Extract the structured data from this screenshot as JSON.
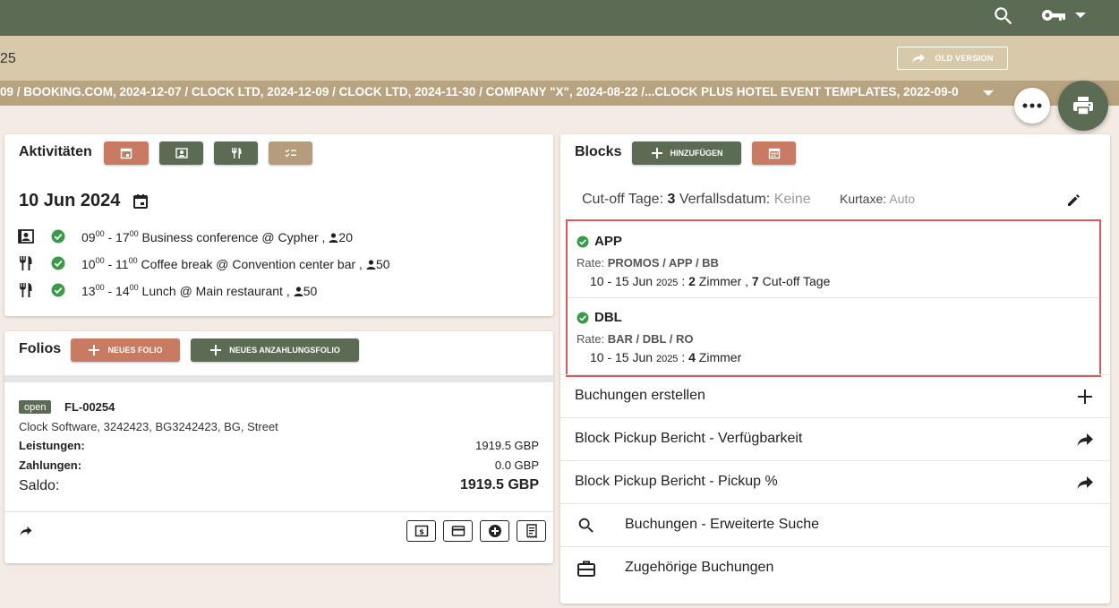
{
  "header": {
    "search_icon": "search-icon",
    "key_icon": "key-icon",
    "menu_caret": "chevron-down-icon"
  },
  "subbar": {
    "title_fragment": "25",
    "old_version_label": "OLD VERSION"
  },
  "breadcrumbs": {
    "text": "09  /  BOOKING.COM, 2024-12-07  /  CLOCK LTD, 2024-12-09  /  CLOCK LTD, 2024-11-30  /  COMPANY \"X\", 2024-08-22  /...CLOCK PLUS HOTEL EVENT TEMPLATES, 2022-09-0"
  },
  "activities": {
    "title": "Aktivitäten",
    "date": "10 Jun 2024",
    "items": [
      {
        "start": "09",
        "start_sup": "00",
        "end": "17",
        "end_sup": "00",
        "desc": "Business conference @ Cypher ,",
        "count": "20",
        "icon": "conference-icon"
      },
      {
        "start": "10",
        "start_sup": "00",
        "end": "11",
        "end_sup": "00",
        "desc": "Coffee break @ Convention center bar ,",
        "count": "50",
        "icon": "restaurant-icon"
      },
      {
        "start": "13",
        "start_sup": "00",
        "end": "14",
        "end_sup": "00",
        "desc": "Lunch @ Main restaurant ,",
        "count": "50",
        "icon": "restaurant-icon"
      }
    ]
  },
  "folios": {
    "title": "Folios",
    "new_folio": "NEUES FOLIO",
    "new_deposit_folio": "NEUES ANZAHLUNGSFOLIO",
    "status": "open",
    "number": "FL-00254",
    "address": "Clock Software, 3242423, BG3242423, BG, Street",
    "services_label": "Leistungen:",
    "services_value": "1919.5 GBP",
    "payments_label": "Zahlungen:",
    "payments_value": "0.0 GBP",
    "balance_label": "Saldo:",
    "balance_value": "1919.5 GBP"
  },
  "blocks": {
    "title": "Blocks",
    "add_label": "HINZUFÜGEN",
    "cutoff_label": "Cut-off Tage:",
    "cutoff_value": "3",
    "expiry_label": "Verfallsdatum:",
    "expiry_value": "Keine",
    "kurtaxe_label": "Kurtaxe:",
    "kurtaxe_value": "Auto",
    "items": [
      {
        "name": "APP",
        "rate_label": "Rate:",
        "rate": "PROMOS / APP / BB",
        "dates": "10 - 15 Jun",
        "year": "2025",
        "rooms": "2",
        "rooms_label": "Zimmer",
        "cutoff": "7",
        "cutoff_label": "Cut-off Tage"
      },
      {
        "name": "DBL",
        "rate_label": "Rate:",
        "rate": "BAR / DBL / RO",
        "dates": "10 - 15 Jun",
        "year": "2025",
        "rooms": "4",
        "rooms_label": "Zimmer"
      }
    ]
  },
  "menu": [
    {
      "label": "Buchungen erstellen"
    },
    {
      "label": "Block Pickup Bericht - Verfügbarkeit"
    },
    {
      "label": "Block Pickup Bericht - Pickup %"
    },
    {
      "label": "Buchungen - Erweiterte Suche"
    },
    {
      "label": "Zugehörige Buchungen"
    }
  ],
  "colors": {
    "topbar": "#5c6b54",
    "subbar": "#d7c9a9",
    "crumbbar": "#b8a380",
    "accent_red": "#c87a62",
    "accent_green": "#5c6b54",
    "accent_tan": "#b59c7c",
    "highlight_border": "#e0575a",
    "ok_green": "#3a9a4a"
  }
}
